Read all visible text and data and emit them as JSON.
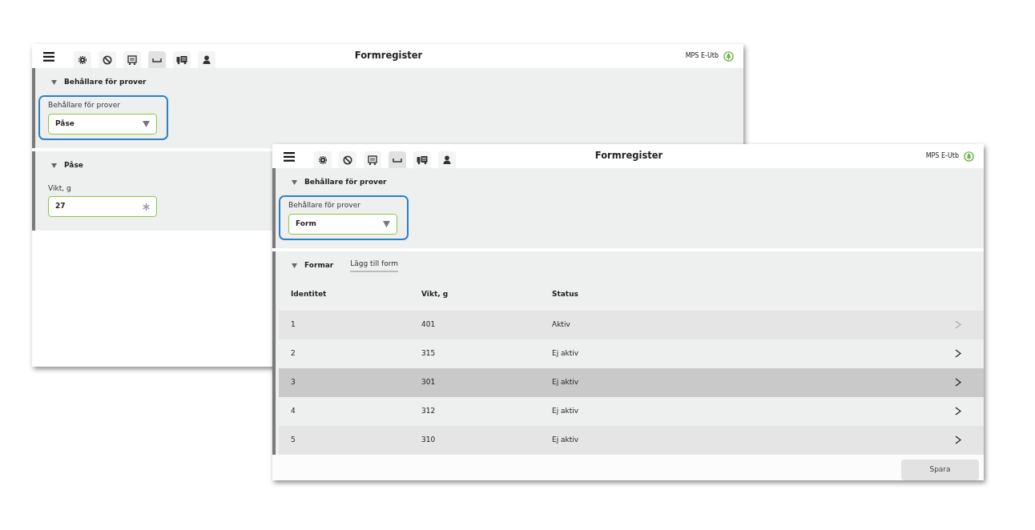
{
  "windows": [
    {
      "title": "Formregister",
      "account": "MPS E-Utb",
      "tabs": [
        {
          "selected": false
        },
        {
          "selected": false
        },
        {
          "selected": false
        },
        {
          "selected": true
        },
        {
          "selected": false
        },
        {
          "selected": false
        }
      ],
      "sections": [
        {
          "heading": "Behållare för prover",
          "expanded": true,
          "fields": [
            {
              "kind": "select",
              "label": "Behållare för prover",
              "value": "Påse",
              "highlighted": true,
              "required": false
            }
          ]
        },
        {
          "heading": "Påse",
          "expanded": true,
          "fields": [
            {
              "kind": "input",
              "label": "Vikt, g",
              "value": "27",
              "highlighted": false,
              "required": true
            }
          ]
        }
      ]
    },
    {
      "title": "Formregister",
      "account": "MPS E-Utb",
      "tabs": [
        {
          "selected": false
        },
        {
          "selected": false
        },
        {
          "selected": false
        },
        {
          "selected": true
        },
        {
          "selected": false
        },
        {
          "selected": false
        }
      ],
      "sections": [
        {
          "heading": "Behållare för prover",
          "expanded": true,
          "fields": [
            {
              "kind": "select",
              "label": "Behållare för prover",
              "value": "Form",
              "highlighted": true,
              "required": false
            }
          ]
        }
      ],
      "list_section": {
        "heading": "Formar",
        "expanded": true,
        "link": "Lägg till form",
        "table": {
          "columns": [
            "Identitet",
            "Vikt, g",
            "Status"
          ],
          "rows": [
            {
              "cells": [
                "1",
                "401",
                "Aktiv"
              ],
              "selected": false,
              "chevron_muted": true
            },
            {
              "cells": [
                "2",
                "315",
                "Ej aktiv"
              ],
              "selected": false,
              "chevron_muted": false
            },
            {
              "cells": [
                "3",
                "301",
                "Ej aktiv"
              ],
              "selected": true,
              "chevron_muted": false
            },
            {
              "cells": [
                "4",
                "312",
                "Ej aktiv"
              ],
              "selected": false,
              "chevron_muted": false
            },
            {
              "cells": [
                "5",
                "310",
                "Ej aktiv"
              ],
              "selected": false,
              "chevron_muted": false
            }
          ]
        }
      },
      "save_button": "Spara"
    }
  ]
}
